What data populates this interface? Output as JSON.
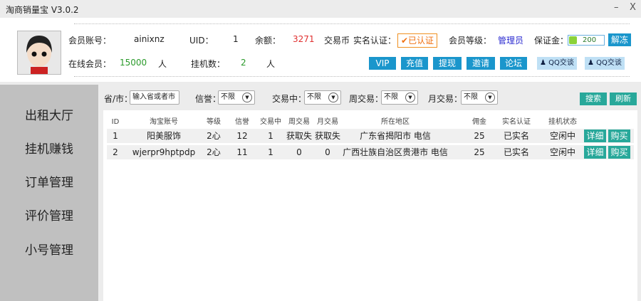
{
  "window": {
    "title": "淘商销量宝 V3.0.2",
    "minimize": "–",
    "close": "X"
  },
  "user": {
    "account_label": "会员账号：",
    "account": "ainixnz",
    "uid_label": "UID：",
    "uid": "1",
    "balance_label": "余额：",
    "balance": "3271",
    "currency": "交易币",
    "realname_label": "实名认证：",
    "realname_status": "已认证",
    "level_label": "会员等级：",
    "level": "管理员",
    "bond_label": "保证金：",
    "bond": "200",
    "unfreeze": "解冻",
    "online_label": "在线会员：",
    "online": "15000",
    "person": "人",
    "hang_label": "挂机数：",
    "hang": "2"
  },
  "actions": [
    "VIP",
    "充值",
    "提现",
    "邀请",
    "论坛"
  ],
  "qq": [
    "QQ交谈",
    "QQ交谈"
  ],
  "sidebar": [
    "出租大厅",
    "挂机赚钱",
    "订单管理",
    "评价管理",
    "小号管理"
  ],
  "filters": {
    "province_label": "省/市：",
    "province_placeholder": "输入省或者市",
    "credit_label": "信誉：",
    "trading_label": "交易中：",
    "weekly_label": "周交易：",
    "monthly_label": "月交易：",
    "any": "不限",
    "search": "搜索",
    "refresh": "刷新"
  },
  "table": {
    "headers": [
      "ID",
      "淘宝账号",
      "等级",
      "信誉",
      "交易中",
      "周交易",
      "月交易",
      "所在地区",
      "佣金",
      "实名认证",
      "挂机状态"
    ],
    "rows": [
      [
        "1",
        "阳美服饰",
        "2心",
        "12",
        "1",
        "获取失",
        "获取失",
        "广东省揭阳市 电信",
        "25",
        "已实名",
        "空闲中"
      ],
      [
        "2",
        "wjerpr9hptpdp",
        "2心",
        "11",
        "1",
        "0",
        "0",
        "广西壮族自治区贵港市 电信",
        "25",
        "已实名",
        "空闲中"
      ]
    ],
    "detail": "详细",
    "buy": "购买"
  },
  "colors": {
    "accent_blue": "#1a96cc",
    "teal": "#28a89a",
    "balance_red": "#e03030",
    "verified_orange": "#f07010"
  }
}
